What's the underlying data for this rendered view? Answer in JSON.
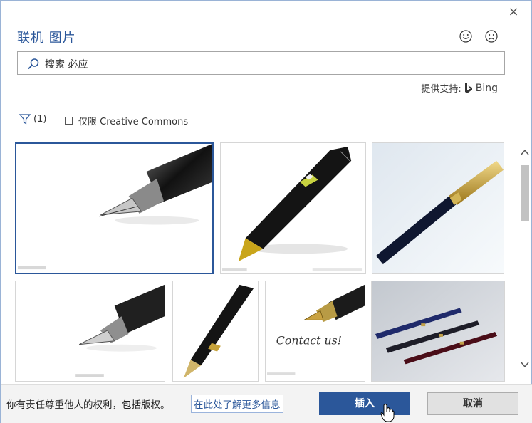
{
  "dialog": {
    "title": "联机 图片",
    "close_glyph": "×"
  },
  "feedback": {
    "smile_icon": "smile-icon",
    "frown_icon": "frown-icon"
  },
  "search": {
    "placeholder": "搜索 必应"
  },
  "provider": {
    "label": "提供支持:",
    "name": "Bing"
  },
  "filter": {
    "count": "(1)",
    "cc_label": "仅限 Creative Commons"
  },
  "gallery": {
    "images": [
      "fountain-pen-nib-closeup",
      "black-gold-ballpoint-pen",
      "black-gold-cap-pen",
      "fountain-pen-nib-closeup-2",
      "black-fountain-pen-diagonal",
      "fountain-pen-contact-us",
      "three-pens-on-table"
    ],
    "caption_3": "Contact us!"
  },
  "footer": {
    "notice": "你有责任尊重他人的权利，包括版权。",
    "more_link": "在此处了解更多信息",
    "insert_label": "插入",
    "cancel_label": "取消"
  },
  "colors": {
    "accent": "#2b579a",
    "footer_bg": "#f3f3f3"
  }
}
